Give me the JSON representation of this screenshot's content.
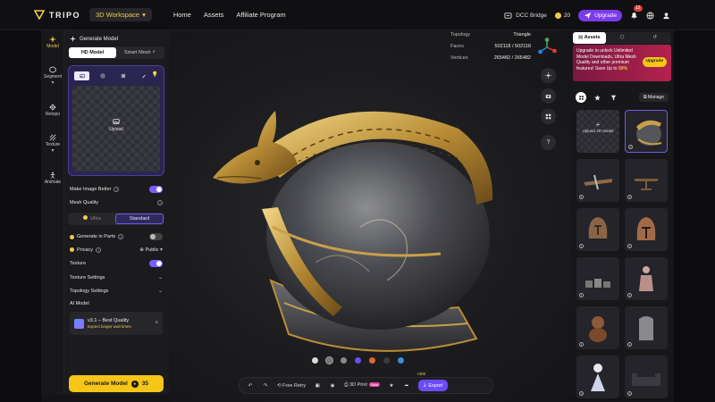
{
  "topbar": {
    "brand": "TRIPO",
    "workspace": "3D Workspace",
    "nav": [
      "Home",
      "Assets",
      "Affiliate Program"
    ],
    "dcc_bridge": "DCC Bridge",
    "credits": "20",
    "upgrade": "Upgrade",
    "notifications": "12",
    "accent": "#f2c94c",
    "upgrade_color": "#7c3aed"
  },
  "rail": {
    "items": [
      {
        "label": "Model",
        "icon": "sparkle-icon"
      },
      {
        "label": "Segment",
        "icon": "cube-split-icon"
      },
      {
        "label": "Retopo",
        "icon": "mesh-icon"
      },
      {
        "label": "Texture",
        "icon": "texture-icon"
      },
      {
        "label": "Animate",
        "icon": "figure-icon"
      }
    ]
  },
  "panel": {
    "title": "Generate Model",
    "tabs": [
      "HD Model",
      "Smart Mesh"
    ],
    "upload_label": "Upload",
    "make_image_better": "Make Image Better",
    "mesh_quality": "Mesh Quality",
    "quality_options": [
      "Ultra",
      "Standard"
    ],
    "generate_in_parts": "Generate in Parts",
    "privacy": "Privacy",
    "privacy_value": "Public",
    "texture": "Texture",
    "texture_settings": "Texture Settings",
    "topology_settings": "Topology Settings",
    "ai_model": "AI Model",
    "ai_model_name": "v3.1 – Best Quality",
    "ai_model_note": "Expect longer wait times",
    "generate_button": "Generate Model",
    "generate_cost": "35"
  },
  "viewport": {
    "stats": [
      {
        "label": "Topology",
        "value": "Triangle"
      },
      {
        "label": "Faces",
        "value": "502118 / 502118"
      },
      {
        "label": "Vertices",
        "value": "265482 / 265482"
      }
    ],
    "help": "?",
    "bottom_bar": {
      "free_retry": "Free Retry",
      "print": "3D Print",
      "new": "New",
      "export": "Export",
      "plus": "+300"
    }
  },
  "assets": {
    "tabs": [
      "Assets",
      "",
      ""
    ],
    "promo_text": "Upgrade to unlock Unlimited Model Downloads, Ultra Mesh Quality and other premium features!  Save Up to",
    "promo_highlight": "50%",
    "promo_button": "Upgrade",
    "manage": "Manage",
    "upload_tile": "Upload 3D Model"
  }
}
